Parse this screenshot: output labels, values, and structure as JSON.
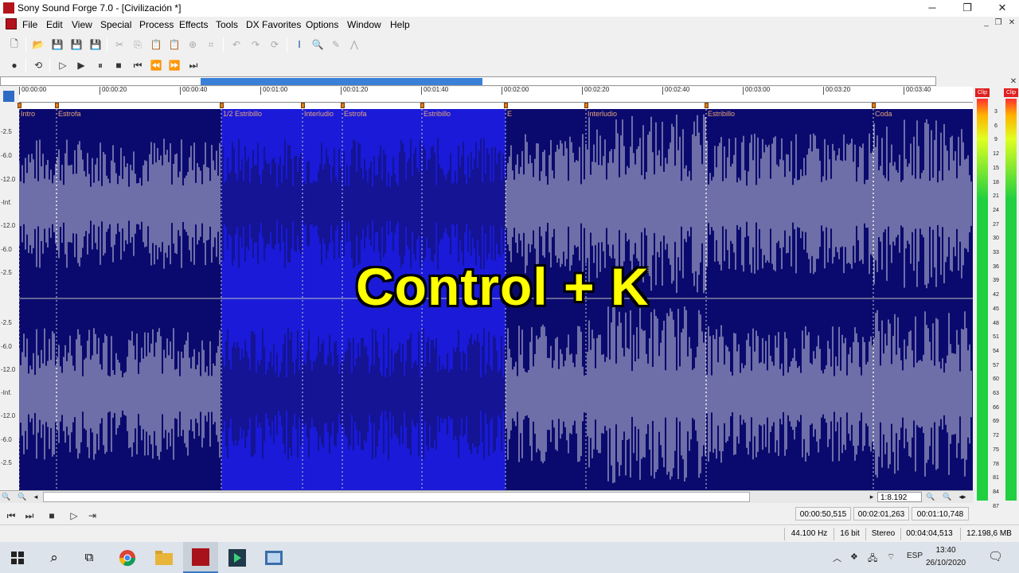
{
  "window": {
    "title": "Sony Sound Forge 7.0 - [Civilización *]",
    "controls": [
      "─",
      "❐",
      "✕"
    ]
  },
  "menu": [
    "File",
    "Edit",
    "View",
    "Special",
    "Process",
    "Effects",
    "Tools",
    "DX Favorites",
    "Options",
    "Window",
    "Help"
  ],
  "timeline": {
    "ticks": [
      "00:00:00",
      "00:00:20",
      "00:00:40",
      "00:01:00",
      "00:01:20",
      "00:01:40",
      "00:02:00",
      "00:02:20",
      "00:02:40",
      "00:03:00",
      "00:03:20",
      "00:03:40"
    ]
  },
  "regions": [
    "Intro",
    "Estrofa",
    "1/2 Estribillo",
    "Interludio",
    "Estrofa",
    "Estribillo",
    "E",
    "Interludio",
    "Estribillo",
    "Coda"
  ],
  "db_scale": [
    "-2.5",
    "-6.0",
    "-12.0",
    "-Inf.",
    "-12.0",
    "-6.0",
    "-2.5",
    "-2.5",
    "-6.0",
    "-12.0",
    "-Inf.",
    "-12.0",
    "-6.0",
    "-2.5"
  ],
  "meter": {
    "clip_label": "Clip",
    "scale": [
      "3",
      "6",
      "9",
      "12",
      "15",
      "18",
      "21",
      "24",
      "27",
      "30",
      "33",
      "36",
      "39",
      "42",
      "45",
      "48",
      "51",
      "54",
      "57",
      "60",
      "63",
      "66",
      "69",
      "72",
      "75",
      "78",
      "81",
      "84",
      "87"
    ]
  },
  "overlay_text": "Control + K",
  "zoom": "1:8.192",
  "selection": {
    "start": "00:00:50,515",
    "end": "00:02:01,263",
    "length": "00:01:10,748"
  },
  "status": {
    "sample_rate": "44.100 Hz",
    "bit_depth": "16 bit",
    "channels": "Stereo",
    "duration": "00:04:04,513",
    "size": "12.198,6 MB"
  },
  "taskbar": {
    "language": "ESP",
    "time": "13:40",
    "date": "26/10/2020"
  },
  "colors": {
    "waveform_bg": "#0a0a6e",
    "selection": "#1a1ad8",
    "overlay": "#ffff00",
    "marker": "#d97d1a"
  }
}
